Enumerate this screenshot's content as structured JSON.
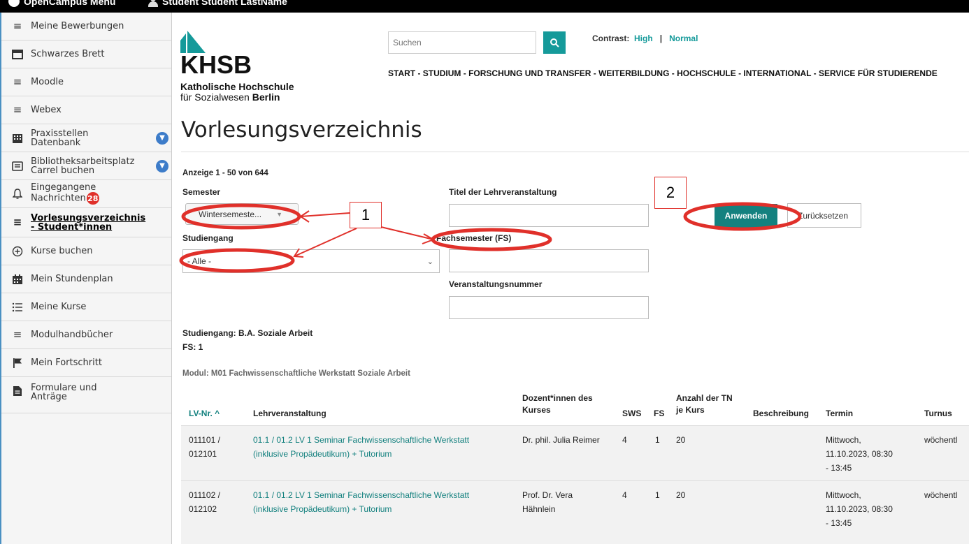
{
  "topbar": {
    "menu_label": "OpenCampus Menu",
    "user_label": "Student Student LastName"
  },
  "sidebar": {
    "items": [
      {
        "label": "Meine Bewerbungen",
        "icon": "menu-lines-icon"
      },
      {
        "label": "Schwarzes Brett",
        "icon": "window-icon"
      },
      {
        "label": "Moodle",
        "icon": "menu-lines-icon"
      },
      {
        "label": "Webex",
        "icon": "menu-lines-icon"
      },
      {
        "label_line1": "Praxisstellen",
        "label_line2": "Datenbank",
        "icon": "building-icon"
      },
      {
        "label_line1": "Bibliotheksarbeitsplatz",
        "label_line2": "Carrel buchen",
        "icon": "list-box-icon"
      },
      {
        "label_line1": "Eingegangene",
        "label_line2": "Nachrichten",
        "badge": "28",
        "icon": "bell-icon"
      },
      {
        "label_line1": "Vorlesungsverzeichnis",
        "label_line2": "- Student*innen",
        "icon": "menu-lines-icon"
      },
      {
        "label": "Kurse buchen",
        "icon": "plus-circle-icon"
      },
      {
        "label": "Mein Stundenplan",
        "icon": "calendar-icon"
      },
      {
        "label": "Meine Kurse",
        "icon": "list-icon"
      },
      {
        "label": "Modulhandbücher",
        "icon": "menu-lines-icon"
      },
      {
        "label": "Mein Fortschritt",
        "icon": "flag-icon"
      },
      {
        "label_line1": "Formulare und",
        "label_line2": "Anträge",
        "icon": "document-icon"
      }
    ]
  },
  "header": {
    "logo_main": "KHSB",
    "logo_sub1": "Katholische Hochschule",
    "logo_sub2_a": "für Sozialwesen ",
    "logo_sub2_b": "Berlin",
    "search_placeholder": "Suchen",
    "contrast_label": "Contrast:",
    "contrast_high": "High",
    "contrast_sep": "|",
    "contrast_normal": "Normal",
    "nav": "START  - STUDIUM  - FORSCHUNG UND TRANSFER  - WEITERBILDUNG  - HOCHSCHULE  - INTERNATIONAL  - SERVICE FÜR STUDIERENDE"
  },
  "main": {
    "title": "Vorlesungsverzeichnis",
    "count": "Anzeige 1 - 50 von 644",
    "semester_label": "Semester",
    "semester_value": "Wintersemeste...",
    "studiengang_label": "Studiengang",
    "studiengang_value": "- Alle -",
    "titel_label": "Titel der Lehrveranstaltung",
    "fs_label": "Fachsemester (FS)",
    "vnr_label": "Veranstaltungsnummer",
    "apply_button": "Anwenden",
    "reset_button": "Zurücksetzen",
    "studiengang_info": "Studiengang: B.A. Soziale Arbeit",
    "fs_info": "FS: 1",
    "modul_info": "Modul: M01 Fachwissenschaftliche Werkstatt Soziale Arbeit"
  },
  "table": {
    "headers": {
      "lvnr": "LV-Nr. ^",
      "lehrveranstaltung": "Lehrveranstaltung",
      "dozent_1": "Dozent*innen des",
      "dozent_2": "Kurses",
      "sws": "SWS",
      "fs": "FS",
      "tn_1": "Anzahl der TN",
      "tn_2": "je Kurs",
      "beschreibung": "Beschreibung",
      "termin": "Termin",
      "turnus": "Turnus"
    },
    "rows": [
      {
        "lvnr_1": "011101 /",
        "lvnr_2": "012101",
        "lv_1": "01.1 / 01.2 LV 1 Seminar Fachwissenschaftliche Werkstatt",
        "lv_2": "(inklusive Propädeutikum) + Tutorium",
        "dozent_1": "Dr. phil. Julia Reimer",
        "dozent_2": "",
        "sws": "4",
        "fs": "1",
        "tn": "20",
        "termin_1": "Mittwoch,",
        "termin_2": "11.10.2023, 08:30",
        "termin_3": "- 13:45",
        "turnus": "wöchentl"
      },
      {
        "lvnr_1": "011102 /",
        "lvnr_2": "012102",
        "lv_1": "01.1 / 01.2 LV 1 Seminar Fachwissenschaftliche Werkstatt",
        "lv_2": "(inklusive Propädeutikum) + Tutorium",
        "dozent_1": "Prof. Dr. Vera",
        "dozent_2": "Hähnlein",
        "sws": "4",
        "fs": "1",
        "tn": "20",
        "termin_1": "Mittwoch,",
        "termin_2": "11.10.2023, 08:30",
        "termin_3": "- 13:45",
        "turnus": "wöchentl"
      }
    ]
  },
  "annotations": {
    "marker_1": "1",
    "marker_2": "2",
    "color": "#e0302a"
  },
  "colors": {
    "accent": "#159a9a",
    "button": "#14817f",
    "sidebar_chevron": "#3d7cc9"
  }
}
